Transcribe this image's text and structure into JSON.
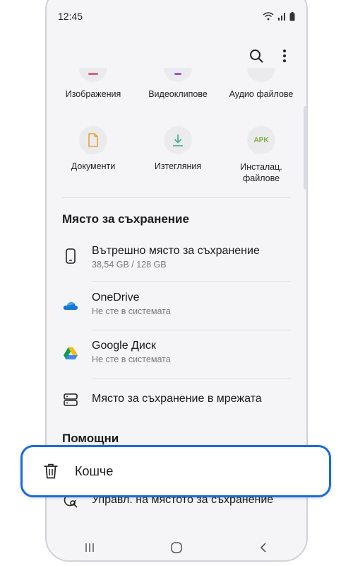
{
  "status_bar": {
    "time": "12:45"
  },
  "toolbar": {
    "search_icon": "search-icon",
    "more_icon": "more-vert-icon"
  },
  "categories": [
    {
      "label": "Изображения",
      "icon": "image-icon"
    },
    {
      "label": "Видеоклипове",
      "icon": "video-icon"
    },
    {
      "label": "Аудио файлове",
      "icon": "audio-icon"
    },
    {
      "label": "Документи",
      "icon": "document-icon"
    },
    {
      "label": "Изтегляния",
      "icon": "download-icon"
    },
    {
      "label": "Инсталац. файлове",
      "icon": "apk-icon",
      "icon_text": "APK"
    }
  ],
  "storage": {
    "title": "Място за съхранение",
    "items": [
      {
        "title": "Вътрешно място за съхранение",
        "subtitle": "38,54 GB / 128 GB",
        "icon": "phone-icon"
      },
      {
        "title": "OneDrive",
        "subtitle": "Не сте в системата",
        "icon": "onedrive-icon"
      },
      {
        "title": "Google Диск",
        "subtitle": "Не сте в системата",
        "icon": "google-drive-icon"
      },
      {
        "title": "Място за съхранение в мрежата",
        "subtitle": "",
        "icon": "network-storage-icon"
      }
    ]
  },
  "utilities": {
    "title": "Помощни",
    "trash_label": "Кошче",
    "manage_label": "Управл. на мястото за съхранение"
  },
  "colors": {
    "highlight": "#1a6dd4",
    "apk_green": "#7bb342",
    "download_green": "#3fae8c",
    "document_orange": "#e8a33c"
  }
}
